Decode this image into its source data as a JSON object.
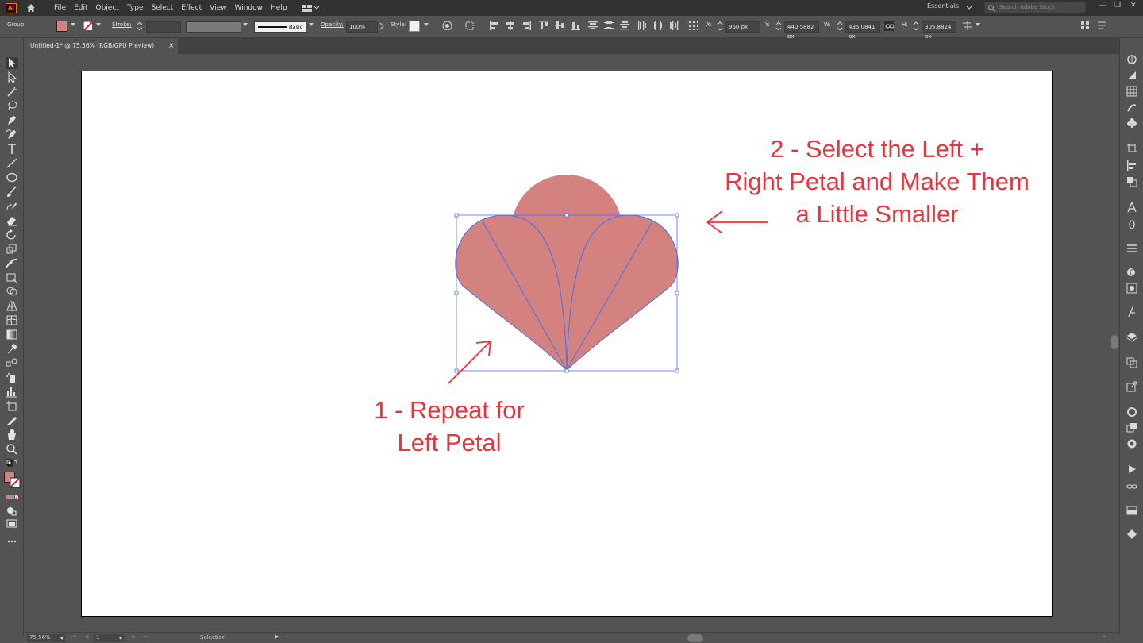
{
  "app": {
    "logo_text": "Ai"
  },
  "menu": {
    "items": [
      "File",
      "Edit",
      "Object",
      "Type",
      "Select",
      "Effect",
      "View",
      "Window",
      "Help"
    ]
  },
  "workspace": {
    "label": "Essentials",
    "search_placeholder": "Search Adobe Stock"
  },
  "control_bar": {
    "selection_type": "Group",
    "fill_color": "#d4827f",
    "stroke_label": "Stroke:",
    "brush_label": "Basic",
    "opacity_label": "Opacity:",
    "opacity_value": "100%",
    "style_label": "Style:",
    "x_label": "X:",
    "x_value": "960 px",
    "y_label": "Y:",
    "y_value": "440,5882 px",
    "w_label": "W:",
    "w_value": "435,0841 px",
    "h_label": "H:",
    "h_value": "305,8824 px"
  },
  "document": {
    "tab_title": "Untitled-1* @ 75,56% (RGB/GPU Preview)",
    "close_glyph": "×"
  },
  "artwork": {
    "petal_color": "#d4827f",
    "selection_color": "#4a6ee8",
    "annotation_color": "#e8343a"
  },
  "annotations": {
    "step1_line1": "1 - Repeat for",
    "step1_line2": "Left Petal",
    "step2_line1": "2 - Select the Left +",
    "step2_line2": "Right Petal and Make Them",
    "step2_line3": "a Little Smaller"
  },
  "status": {
    "zoom": "75,56%",
    "artboard_number": "1",
    "tool_name": "Selection"
  }
}
